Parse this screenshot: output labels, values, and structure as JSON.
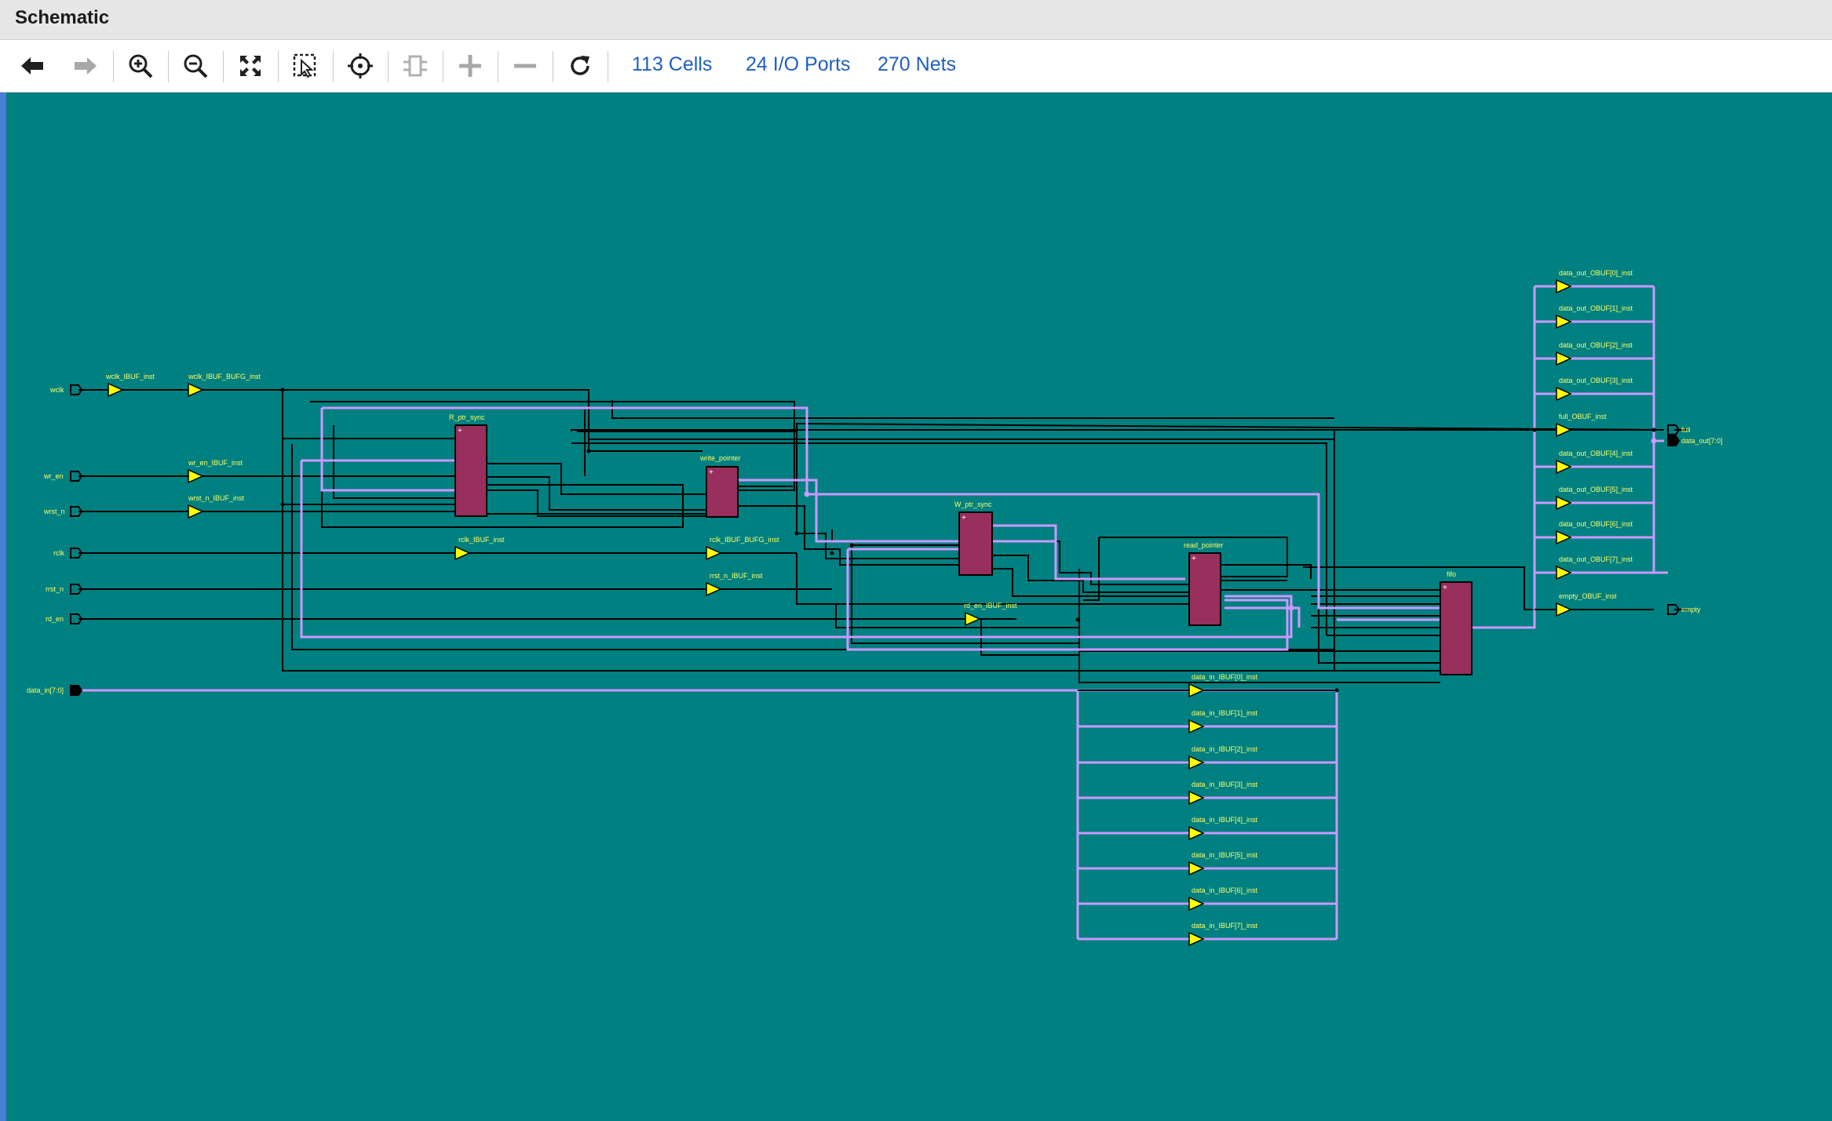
{
  "window": {
    "title": "Schematic"
  },
  "toolbar": {
    "buttons": [
      {
        "name": "back-button",
        "icon": "arrow-left-icon",
        "enabled": true
      },
      {
        "name": "forward-button",
        "icon": "arrow-right-icon",
        "enabled": false
      },
      {
        "name": "zoom-in-button",
        "icon": "zoom-in-icon",
        "enabled": true
      },
      {
        "name": "zoom-out-button",
        "icon": "zoom-out-icon",
        "enabled": true
      },
      {
        "name": "zoom-fit-button",
        "icon": "fit-screen-icon",
        "enabled": true
      },
      {
        "name": "zoom-area-button",
        "icon": "zoom-area-icon",
        "enabled": true
      },
      {
        "name": "autofit-selection-button",
        "icon": "crosshair-icon",
        "enabled": true
      },
      {
        "name": "regenerate-button",
        "icon": "cell-icon",
        "enabled": false
      },
      {
        "name": "expand-button",
        "icon": "plus-icon",
        "enabled": false
      },
      {
        "name": "collapse-button",
        "icon": "minus-icon",
        "enabled": false
      },
      {
        "name": "refresh-button",
        "icon": "refresh-icon",
        "enabled": true
      }
    ],
    "stats": {
      "cells": "113 Cells",
      "ports": "24 I/O Ports",
      "nets": "270 Nets"
    }
  },
  "colors": {
    "canvas_background": "#008080",
    "cell_fill": "#992f5d",
    "bus_wire": "#cc99ff",
    "net_wire": "#000000",
    "buffer_fill": "#ffff00",
    "label_text": "#ffff66"
  },
  "schematic": {
    "input_ports": [
      "wclk",
      "wr_en",
      "wrst_n",
      "rclk",
      "rrst_n",
      "rd_en",
      "data_in[7:0]"
    ],
    "output_ports": [
      "full",
      "data_out[7:0]",
      "empty"
    ],
    "cells": [
      "R_ptr_sync",
      "write_pointer",
      "W_ptr_sync",
      "read_pointer",
      "fifo"
    ],
    "buffers": [
      "wclk_IBUF_inst",
      "wclk_IBUF_BUFG_inst",
      "wr_en_IBUF_inst",
      "wrst_n_IBUF_inst",
      "rclk_IBUF_inst",
      "rclk_IBUF_BUFG_inst",
      "rrst_n_IBUF_inst",
      "rd_en_IBUF_inst",
      "data_in_IBUF[0]_inst",
      "data_in_IBUF[1]_inst",
      "data_in_IBUF[2]_inst",
      "data_in_IBUF[3]_inst",
      "data_in_IBUF[4]_inst",
      "data_in_IBUF[5]_inst",
      "data_in_IBUF[6]_inst",
      "data_in_IBUF[7]_inst",
      "data_out_OBUF[0]_inst",
      "data_out_OBUF[1]_inst",
      "data_out_OBUF[2]_inst",
      "data_out_OBUF[3]_inst",
      "full_OBUF_inst",
      "data_out_OBUF[4]_inst",
      "data_out_OBUF[5]_inst",
      "data_out_OBUF[6]_inst",
      "data_out_OBUF[7]_inst",
      "empty_OBUF_inst"
    ]
  }
}
